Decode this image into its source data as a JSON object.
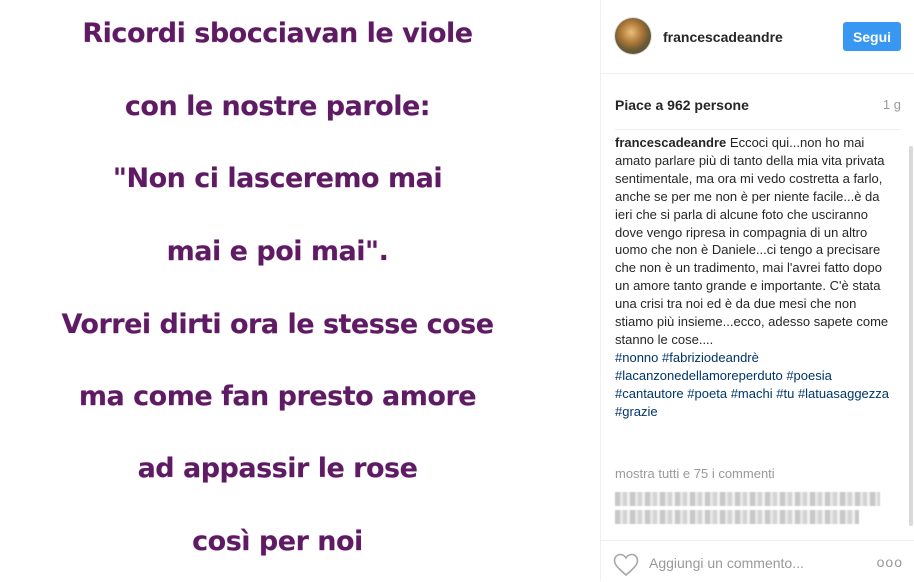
{
  "post": {
    "poem_lines": [
      "Ricordi sbocciavan le viole",
      "con le nostre parole:",
      "\"Non ci lasceremo mai",
      "mai e poi mai\".",
      "Vorrei dirti ora le stesse cose",
      "ma come fan presto amore",
      "ad appassir le rose",
      "così per noi"
    ]
  },
  "header": {
    "username": "francescadeandre",
    "follow_label": "Segui",
    "avatar_icon": "profile-photo"
  },
  "likes": {
    "text": "Piace a 962 persone",
    "time": "1 g"
  },
  "caption": {
    "username": "francescadeandre",
    "text": "Eccoci qui...non ho mai amato parlare più di tanto della mia vita privata sentimentale, ma ora mi vedo costretta a farlo, anche se per me non è per niente facile...è da ieri che si parla di alcune foto che usciranno dove vengo ripresa in compagnia di un altro uomo che non è Daniele...ci tengo a precisare che non è un tradimento, mai l'avrei fatto dopo un amore tanto grande e importante. C'è stata una crisi tra noi ed è da due mesi che non stiamo più insieme...ecco, adesso sapete come stanno le cose....",
    "hashtags": [
      "#nonno",
      "#fabriziodeandrè",
      "#lacanzonedellamoreperduto",
      "#poesia",
      "#cantautore",
      "#poeta",
      "#machi",
      "#tu",
      "#latuasaggezza",
      "#grazie"
    ]
  },
  "comments": {
    "show_all": "mostra tutti e 75 i commenti"
  },
  "bottom": {
    "heart_icon": "heart-outline",
    "comment_placeholder": "Aggiungi un commento...",
    "more_label": "ooo"
  }
}
